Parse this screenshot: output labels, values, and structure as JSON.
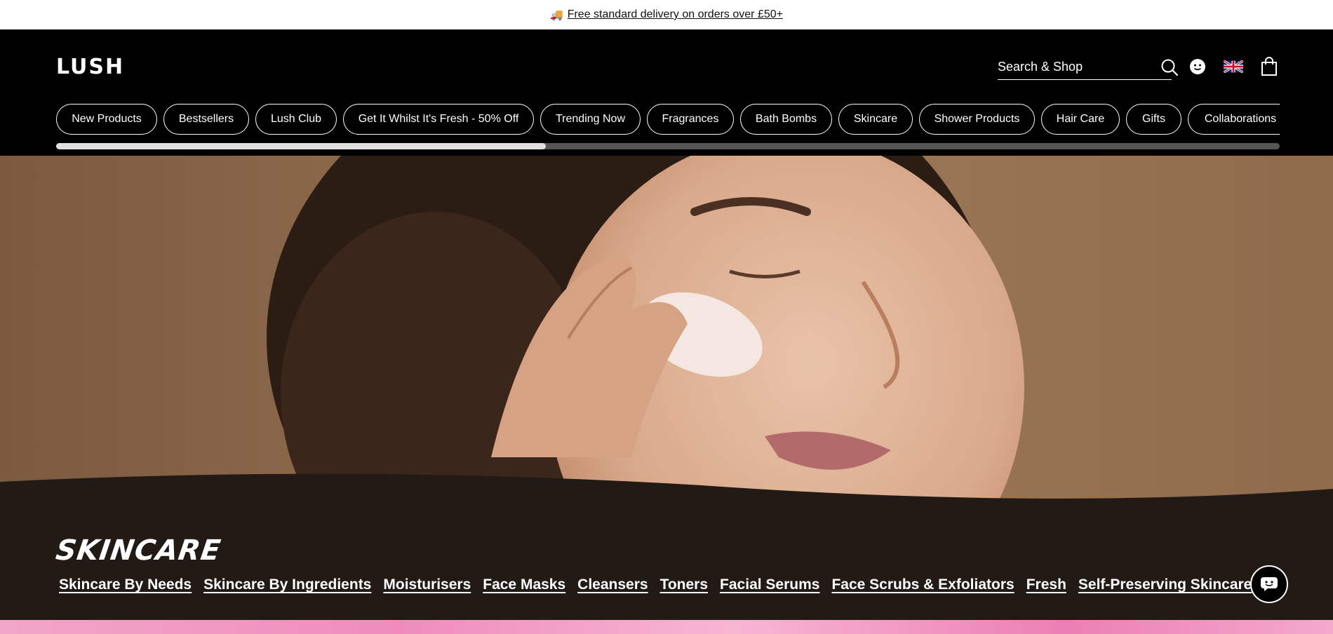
{
  "promo": {
    "icon": "truck-icon",
    "glyph": "🚚",
    "text": "Free standard delivery on orders over £50+"
  },
  "header": {
    "logo": "LUSH",
    "search": {
      "placeholder": "Search & Shop",
      "value": ""
    },
    "icons": [
      "search-icon",
      "account-icon",
      "uk-flag-icon",
      "shopping-bag-icon"
    ]
  },
  "nav": {
    "items": [
      "New Products",
      "Bestsellers",
      "Lush Club",
      "Get It Whilst It's Fresh - 50% Off",
      "Trending Now",
      "Fragrances",
      "Bath Bombs",
      "Skincare",
      "Shower Products",
      "Hair Care",
      "Gifts",
      "Collaborations"
    ],
    "scroll_progress": 0.4
  },
  "category": {
    "title": "SKINCARE",
    "links": [
      "Skincare By Needs",
      "Skincare By Ingredients",
      "Moisturisers",
      "Face Masks",
      "Cleansers",
      "Toners",
      "Facial Serums",
      "Face Scrubs & Exfoliators",
      "Fresh",
      "Self-Preserving Skincare"
    ]
  },
  "colors": {
    "header_bg": "#000000",
    "band_bg": "#221a15",
    "hero_bg": "#8e6a4c",
    "accent_pink": "#ef8cbd"
  },
  "chat": {
    "icon": "chat-icon"
  }
}
